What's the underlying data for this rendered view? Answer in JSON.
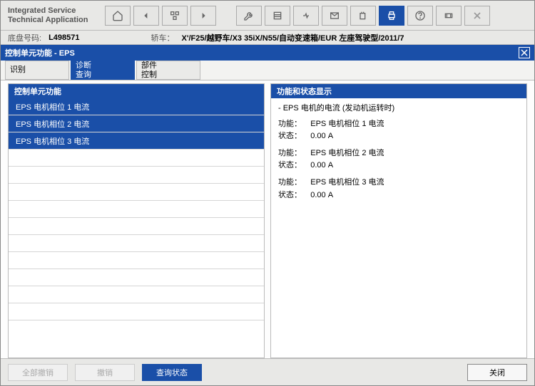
{
  "app": {
    "title_line1": "Integrated Service",
    "title_line2": "Technical Application"
  },
  "info": {
    "chassis_label": "底盘号码:",
    "chassis_value": "L498571",
    "vehicle_label": "轿车：",
    "vehicle_value": "X'/F25/越野车/X3 35iX/N55/自动变速箱/EUR 左座驾驶型/2011/7"
  },
  "section": {
    "title": "控制单元功能 - EPS"
  },
  "tabs": [
    {
      "label": "识别",
      "active": false
    },
    {
      "label": "诊断\n查询",
      "active": true
    },
    {
      "label": "部件\n控制",
      "active": false
    }
  ],
  "leftPanel": {
    "header": "控制单元功能",
    "items": [
      {
        "label": "EPS 电机相位 1 电流",
        "selected": true
      },
      {
        "label": "EPS 电机相位 2 电流",
        "selected": true
      },
      {
        "label": "EPS 电机相位 3 电流",
        "selected": true
      }
    ]
  },
  "rightPanel": {
    "header": "功能和状态显示",
    "heading": "- EPS 电机的电流 (发动机运转时)",
    "func_label": "功能：",
    "stat_label": "状态：",
    "entries": [
      {
        "func": "EPS 电机相位 1 电流",
        "stat": "0.00 A"
      },
      {
        "func": "EPS 电机相位 2 电流",
        "stat": "0.00 A"
      },
      {
        "func": "EPS 电机相位 3 电流",
        "stat": "0.00 A"
      }
    ]
  },
  "footer": {
    "reset_all": "全部撤销",
    "reset": "撤销",
    "query": "查询状态",
    "close": "关闭"
  }
}
